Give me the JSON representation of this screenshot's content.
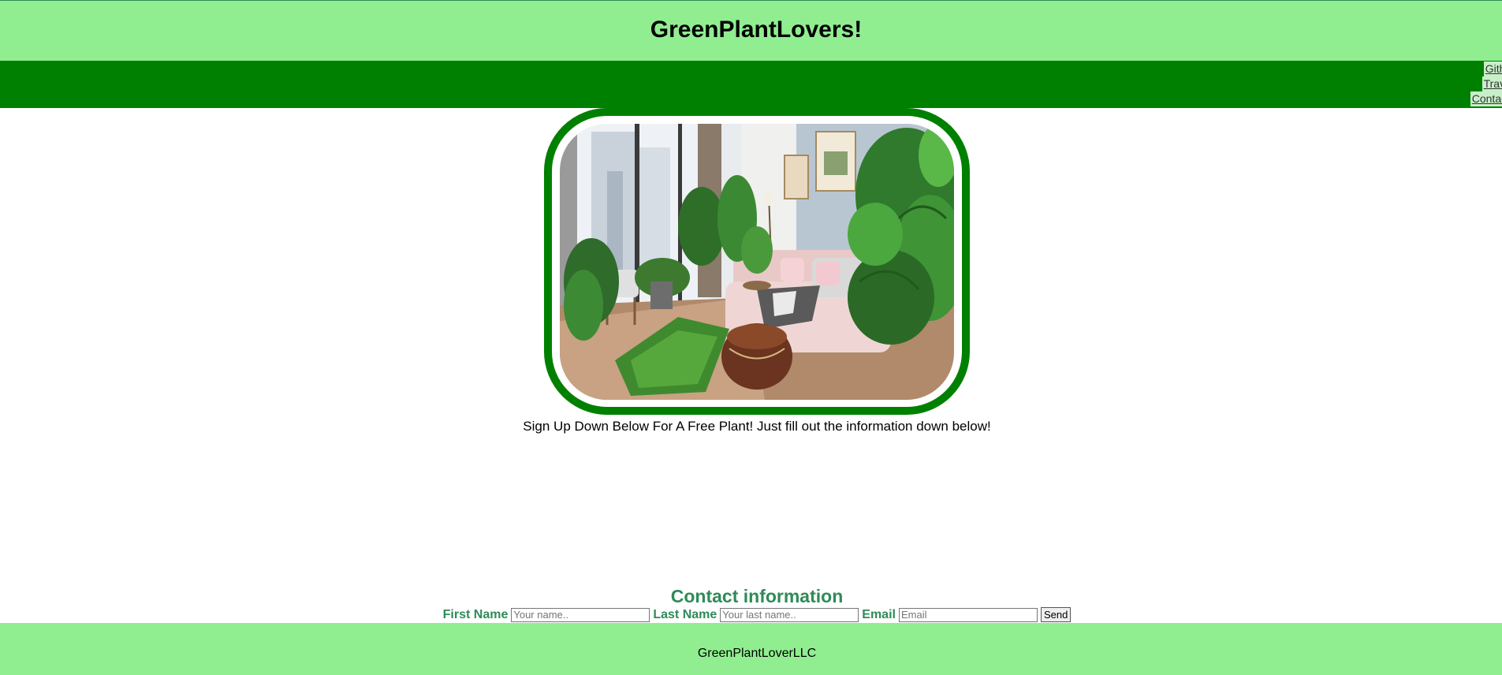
{
  "header": {
    "title": "GreenPlantLovers!"
  },
  "nav": {
    "items": [
      {
        "label": "Github"
      },
      {
        "label": "Travel"
      },
      {
        "label": "Contact"
      }
    ]
  },
  "hero": {
    "image_alt": "living room with plants",
    "tagline": "Sign Up Down Below For A Free Plant! Just fill out the information down below!"
  },
  "contact": {
    "title": "Contact information",
    "first_name_label": "First Name",
    "first_name_placeholder": "Your name..",
    "first_name_value": "",
    "last_name_label": "Last Name",
    "last_name_placeholder": "Your last name..",
    "last_name_value": "",
    "email_label": "Email",
    "email_placeholder": "Email",
    "email_value": "",
    "send_label": "Send"
  },
  "footer": {
    "text": "GreenPlantLoverLLC"
  },
  "colors": {
    "header_bg": "#90ee90",
    "nav_bg": "#008000",
    "contact_text": "#2e8b57",
    "frame_border": "#008000"
  }
}
